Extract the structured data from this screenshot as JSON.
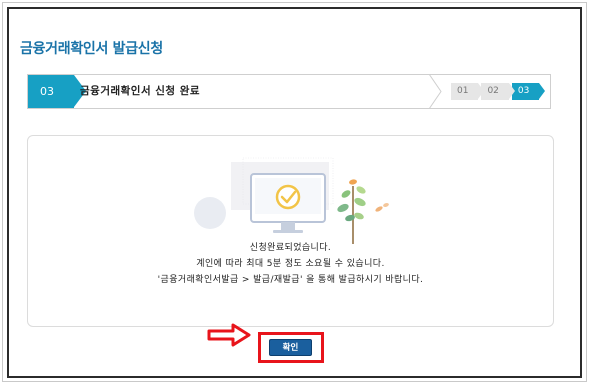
{
  "page": {
    "title": "금융거래확인서 발급신청"
  },
  "stepbar": {
    "current_number": "03",
    "current_label": "금융거래확인서 신청 완료",
    "steps": [
      "01",
      "02",
      "03"
    ],
    "active_step_index": 2
  },
  "result": {
    "line1": "신청완료되었습니다.",
    "line2": "계인에 따라 최대 5분 정도 소요될 수 있습니다.",
    "line3": "'금융거래확인서발급 > 발급/재발급' 을 통해 발급하시기 바랍니다."
  },
  "actions": {
    "confirm_label": "확인"
  },
  "colors": {
    "accent": "#17a0c4",
    "title": "#1a73a8",
    "button": "#1a5f9e",
    "highlight": "#e8141b"
  },
  "icons": {
    "illustration": "monitor-with-checkmark",
    "pointer": "right-arrow-icon"
  }
}
